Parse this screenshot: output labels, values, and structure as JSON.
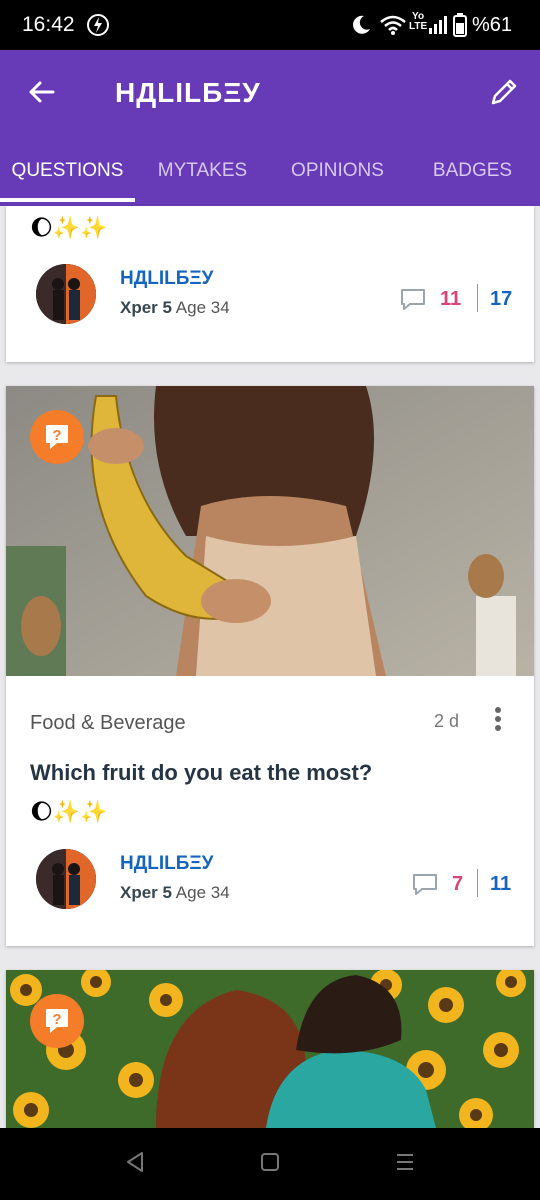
{
  "status_bar": {
    "time": "16:42",
    "battery": "%61",
    "network_label_top": "Yo",
    "network_label_bottom": "LTE"
  },
  "app_bar": {
    "title": "НДLILБΞУ",
    "tabs": [
      {
        "label": "QUESTIONS",
        "active": true
      },
      {
        "label": "MYTAKES",
        "active": false
      },
      {
        "label": "OPINIONS",
        "active": false
      },
      {
        "label": "BADGES",
        "active": false
      }
    ]
  },
  "cards": [
    {
      "emoji": "🌔✨✨",
      "author": {
        "name": "НДLILБΞУ",
        "level": "Xper 5",
        "age": "Age 34"
      },
      "stats": {
        "opinions": "11",
        "views": "17"
      }
    },
    {
      "category": "Food & Beverage",
      "time_ago": "2 d",
      "title": "Which fruit do you eat the most?",
      "emoji": "🌔✨✨",
      "author": {
        "name": "НДLILБΞУ",
        "level": "Xper 5",
        "age": "Age 34"
      },
      "stats": {
        "opinions": "7",
        "views": "11"
      }
    },
    {
      "image_subject": "couple-in-sunflower-field"
    }
  ],
  "colors": {
    "primary": "#673ab7",
    "accent_orange": "#f57c29",
    "opinion_count": "#d8437a",
    "view_count": "#1565c0"
  }
}
